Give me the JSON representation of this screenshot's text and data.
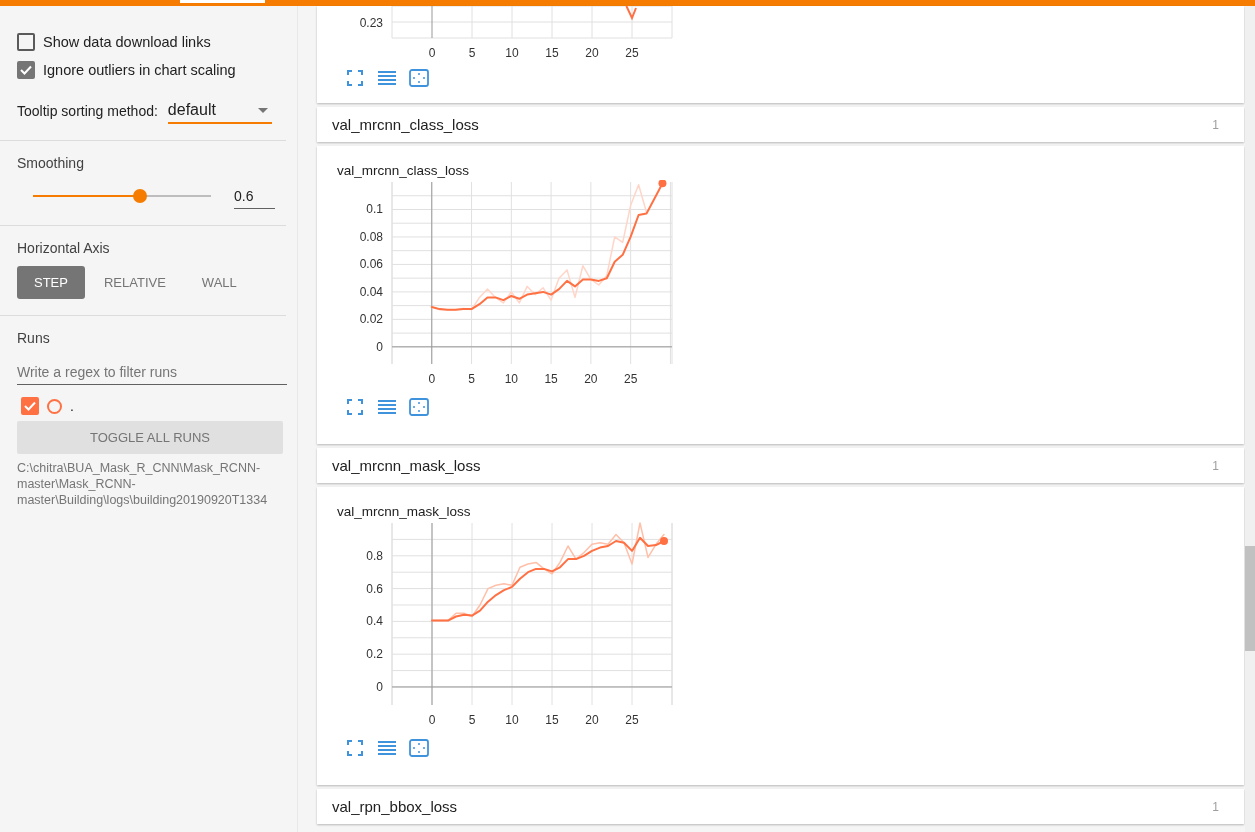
{
  "sidebar": {
    "options": [
      {
        "label": "Show data download links",
        "checked": false
      },
      {
        "label": "Ignore outliers in chart scaling",
        "checked": true
      }
    ],
    "tooltip_sorting": {
      "label": "Tooltip sorting method:",
      "value": "default"
    },
    "smoothing": {
      "title": "Smoothing",
      "level": 0.6,
      "value": "0.6"
    },
    "horizontal_axis": {
      "title": "Horizontal Axis",
      "options": [
        {
          "label": "STEP",
          "selected": true
        },
        {
          "label": "RELATIVE",
          "selected": false
        },
        {
          "label": "WALL",
          "selected": false
        }
      ]
    },
    "runs": {
      "title": "Runs",
      "filter": {
        "placeholder": "Write a regex to filter runs"
      },
      "items": [
        {
          "label": ".",
          "checked": true,
          "color": "#ff7043"
        }
      ],
      "toggle_button": "TOGGLE ALL RUNS",
      "path": "C:\\chitra\\BUA_Mask_R_CNN\\Mask_RCNN-master\\Mask_RCNN-master\\Building\\logs\\building20190920T1334"
    }
  },
  "main": {
    "top_card": {
      "y_tick_label": "0.23",
      "x_tick_labels": [
        "0",
        "5",
        "10",
        "15",
        "20",
        "25"
      ]
    },
    "sections": [
      {
        "title": "val_mrcnn_class_loss",
        "count": "1",
        "card": {
          "chart_title": "val_mrcnn_class_loss",
          "chart_data": {
            "type": "line",
            "x": [
              0,
              1,
              2,
              3,
              4,
              5,
              6,
              7,
              8,
              9,
              10,
              11,
              12,
              13,
              14,
              15,
              16,
              17,
              18,
              19,
              20,
              21,
              22,
              23,
              24,
              25,
              26,
              27,
              28,
              29
            ],
            "series": [
              {
                "color": "#ff7043",
                "values": [
                  0.029,
                  0.0275,
                  0.027,
                  0.027,
                  0.0275,
                  0.0275,
                  0.031,
                  0.036,
                  0.036,
                  0.034,
                  0.037,
                  0.035,
                  0.038,
                  0.039,
                  0.04,
                  0.038,
                  0.042,
                  0.048,
                  0.044,
                  0.049,
                  0.049,
                  0.048,
                  0.05,
                  0.062,
                  0.067,
                  0.08,
                  0.096,
                  0.097,
                  0.108,
                  0.119
                ]
              },
              {
                "color": "#ffd5c8",
                "values": [
                  0.029,
                  0.027,
                  0.027,
                  0.027,
                  0.028,
                  0.027,
                  0.036,
                  0.042,
                  0.036,
                  0.032,
                  0.04,
                  0.032,
                  0.044,
                  0.038,
                  0.043,
                  0.034,
                  0.05,
                  0.056,
                  0.036,
                  0.059,
                  0.049,
                  0.045,
                  0.052,
                  0.08,
                  0.076,
                  0.103,
                  0.118,
                  0.098,
                  null,
                  null
                ]
              }
            ],
            "xlim": [
              -5,
              30.2
            ],
            "ylim": [
              -0.0125,
              0.12
            ],
            "grid": true,
            "xticks": [
              0,
              5,
              10,
              15,
              20,
              25
            ],
            "yticks": [
              0,
              0.02,
              0.04,
              0.06,
              0.08,
              0.1
            ]
          }
        }
      },
      {
        "title": "val_mrcnn_mask_loss",
        "count": "1",
        "card": {
          "chart_title": "val_mrcnn_mask_loss",
          "chart_data": {
            "type": "line",
            "x": [
              0,
              1,
              2,
              3,
              4,
              5,
              6,
              7,
              8,
              9,
              10,
              11,
              12,
              13,
              14,
              15,
              16,
              17,
              18,
              19,
              20,
              21,
              22,
              23,
              24,
              25,
              26,
              27,
              28,
              29
            ],
            "series": [
              {
                "color": "#ff7043",
                "values": [
                  0.405,
                  0.405,
                  0.405,
                  0.43,
                  0.44,
                  0.435,
                  0.465,
                  0.52,
                  0.56,
                  0.59,
                  0.61,
                  0.66,
                  0.7,
                  0.72,
                  0.72,
                  0.705,
                  0.73,
                  0.78,
                  0.78,
                  0.8,
                  0.83,
                  0.85,
                  0.86,
                  0.89,
                  0.88,
                  0.83,
                  0.91,
                  0.86,
                  0.865,
                  0.89
                ]
              },
              {
                "color": "#ffbfa8",
                "values": [
                  0.405,
                  0.405,
                  0.405,
                  0.45,
                  0.45,
                  0.43,
                  0.5,
                  0.6,
                  0.62,
                  0.63,
                  0.62,
                  0.73,
                  0.75,
                  0.76,
                  0.72,
                  0.69,
                  0.76,
                  0.86,
                  0.78,
                  0.82,
                  0.87,
                  0.88,
                  0.87,
                  0.93,
                  0.88,
                  0.75,
                  1.0,
                  0.79,
                  0.87,
                  0.93
                ]
              }
            ],
            "xlim": [
              -5,
              30
            ],
            "ylim": [
              -0.11,
              1.0
            ],
            "grid": true,
            "xticks": [
              0,
              5,
              10,
              15,
              20,
              25
            ],
            "yticks": [
              0,
              0.2,
              0.4,
              0.6,
              0.8
            ]
          }
        }
      },
      {
        "title": "val_rpn_bbox_loss",
        "count": "1"
      }
    ]
  }
}
